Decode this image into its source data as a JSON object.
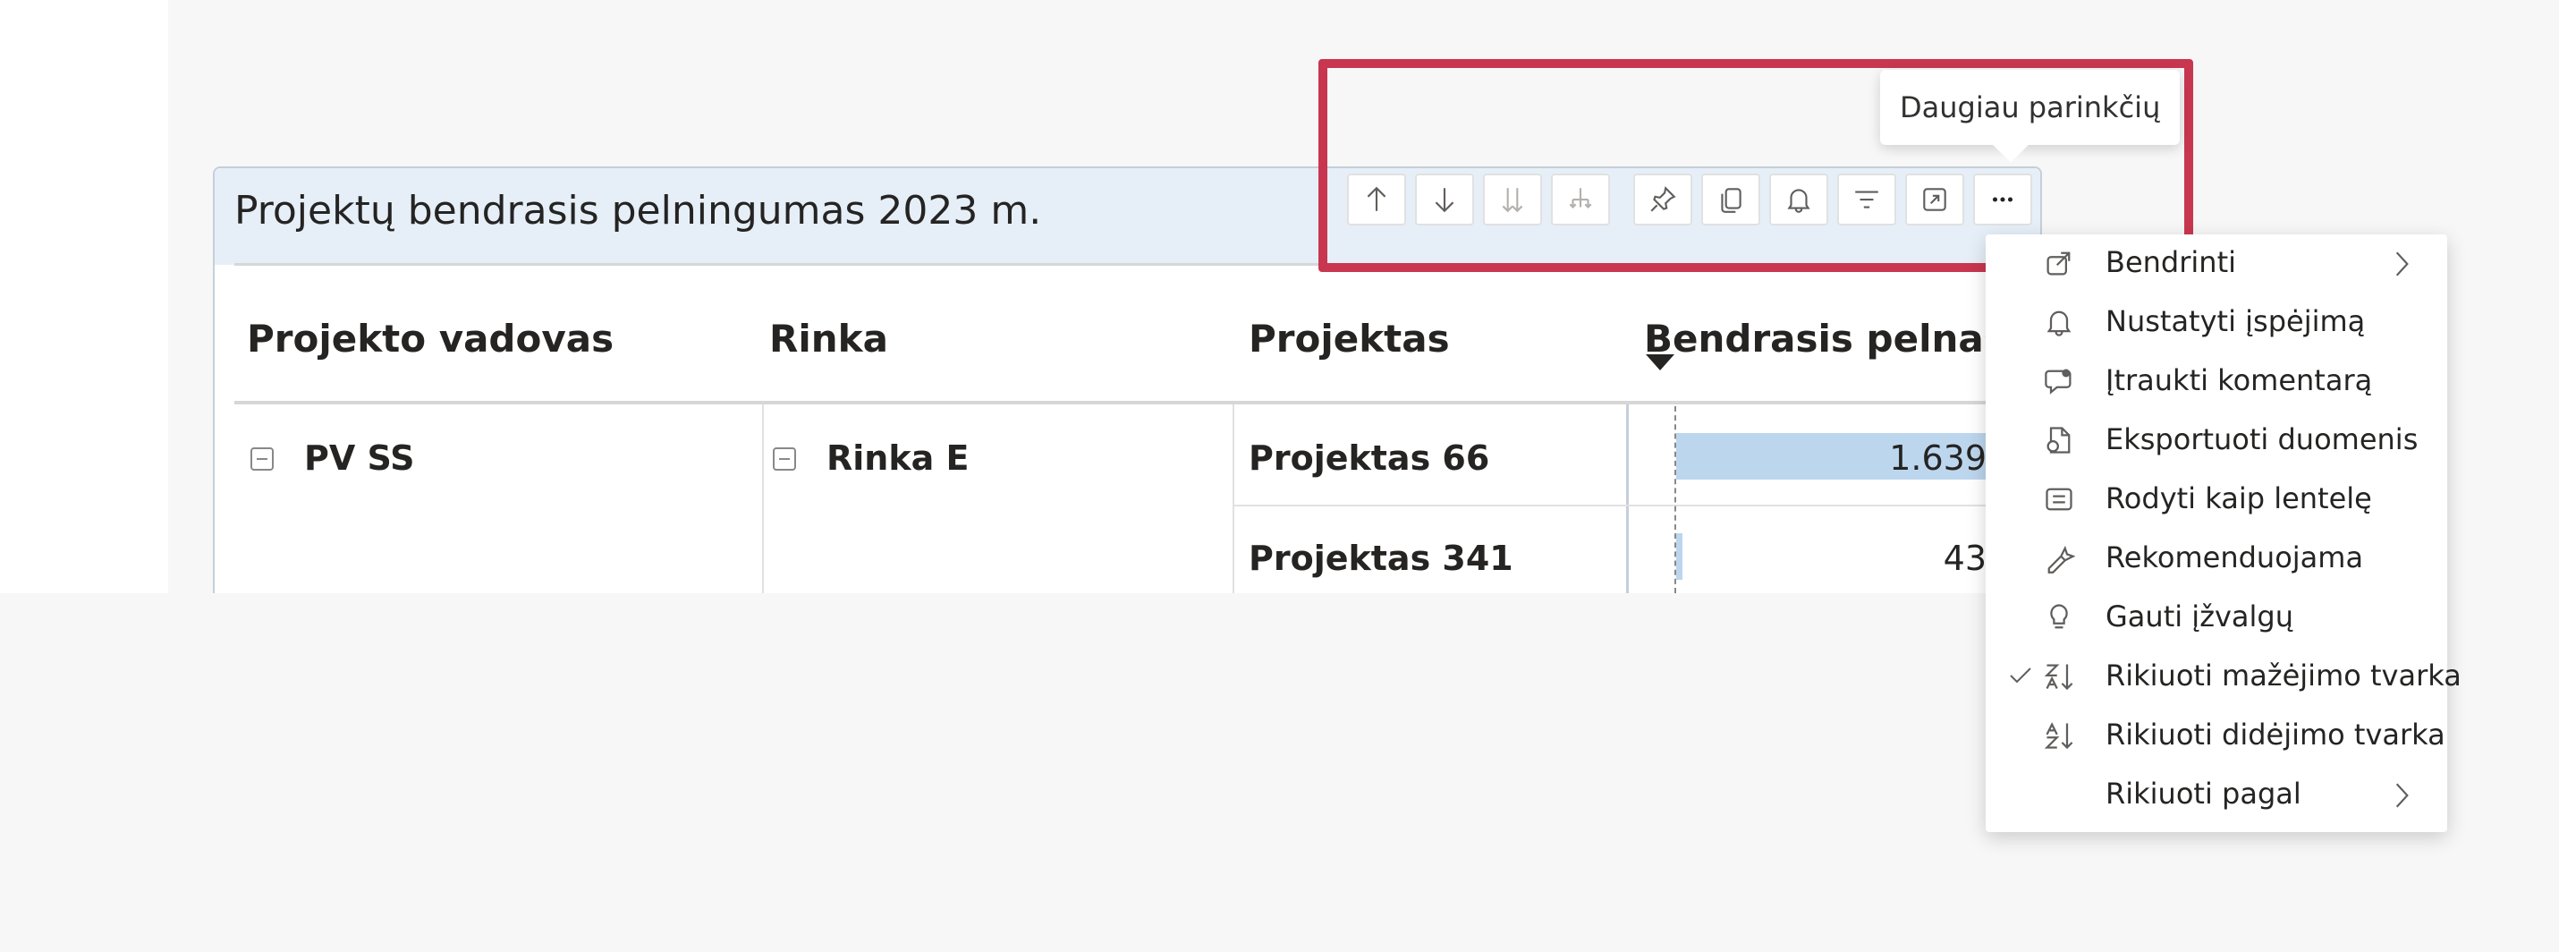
{
  "visual": {
    "title": "Projektų bendrasis pelningumas 2023 m.",
    "columns": [
      "Projekto vadovas",
      "Rinka",
      "Projektas",
      "Bendrasis pelnas"
    ],
    "rows": [
      {
        "manager": "PV SS",
        "market": "Rinka E",
        "project": "Projektas 66",
        "profit": "1.639",
        "profit_share": 1.0
      },
      {
        "manager": "",
        "market": "",
        "project": "Projektas 341",
        "profit": "43",
        "profit_share": 0.02
      }
    ]
  },
  "toolbar": {
    "buttons": [
      {
        "icon": "arrow-up-icon"
      },
      {
        "icon": "arrow-down-icon"
      },
      {
        "icon": "expand-all-down-icon"
      },
      {
        "icon": "hierarchy-icon"
      },
      {
        "icon": "pin-icon"
      },
      {
        "icon": "copy-icon"
      },
      {
        "icon": "bell-icon"
      },
      {
        "icon": "filter-icon"
      },
      {
        "icon": "focus-mode-icon"
      },
      {
        "icon": "more-options-icon"
      }
    ],
    "tooltip": "Daugiau parinkčių"
  },
  "menu": {
    "items": [
      {
        "label": "Bendrinti",
        "icon": "share-icon",
        "submenu": true,
        "checked": false
      },
      {
        "label": "Nustatyti įspėjimą",
        "icon": "bell-icon",
        "submenu": false,
        "checked": false
      },
      {
        "label": "Įtraukti komentarą",
        "icon": "comment-icon",
        "submenu": false,
        "checked": false
      },
      {
        "label": "Eksportuoti duomenis",
        "icon": "export-icon",
        "submenu": false,
        "checked": false
      },
      {
        "label": "Rodyti kaip lentelę",
        "icon": "table-view-icon",
        "submenu": false,
        "checked": false
      },
      {
        "label": "Rekomenduojama",
        "icon": "sparkle-icon",
        "submenu": false,
        "checked": false
      },
      {
        "label": "Gauti įžvalgų",
        "icon": "lightbulb-icon",
        "submenu": false,
        "checked": false
      },
      {
        "label": "Rikiuoti mažėjimo tvarka",
        "icon": "sort-descending-icon",
        "submenu": false,
        "checked": true
      },
      {
        "label": "Rikiuoti didėjimo tvarka",
        "icon": "sort-ascending-icon",
        "submenu": false,
        "checked": false
      },
      {
        "label": "Rikiuoti pagal",
        "icon": "",
        "submenu": true,
        "checked": false
      }
    ]
  },
  "colors": {
    "highlight": "#c8374f",
    "header_bg": "#e6eff8",
    "bar": "#bcd6ee"
  }
}
